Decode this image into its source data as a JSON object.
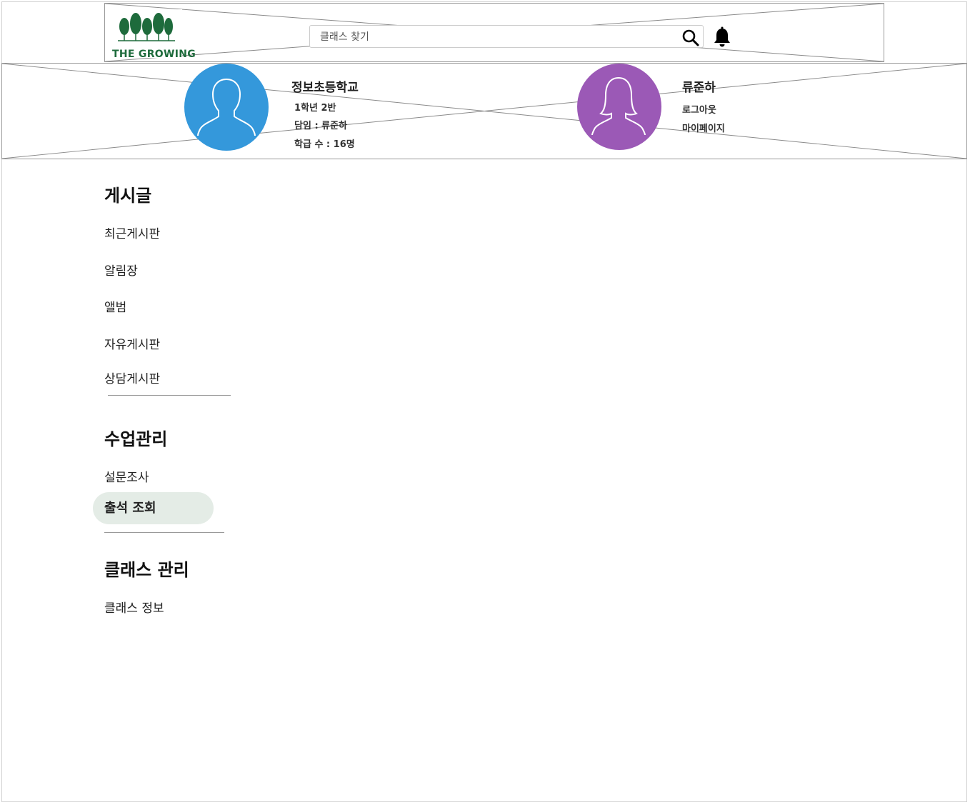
{
  "header": {
    "logo_text": "THE GROWING",
    "search": {
      "placeholder": "클래스 찾기",
      "value": ""
    },
    "icons": [
      "search-icon",
      "bell-icon"
    ]
  },
  "class_info": {
    "school": "정보초등학교",
    "grade_class": "1학년 2반",
    "teacher": "담임 : 류준하",
    "students": "학급 수 : 16명",
    "avatar_color": "#3498db"
  },
  "user": {
    "name": "류준하",
    "logout": "로그아웃",
    "mypage": "마이페이지",
    "avatar_color": "#9b59b6"
  },
  "sidebar": {
    "posts": {
      "title": "게시글",
      "items": [
        "최근게시판",
        "알림장",
        "앨범",
        "자유게시판",
        "상담게시판"
      ]
    },
    "lesson": {
      "title": "수업관리",
      "items": [
        "설문조사",
        "출석 조회"
      ],
      "active": "출석 조회"
    },
    "class_mgmt": {
      "title": "클래스 관리",
      "items": [
        "클래스 정보"
      ]
    }
  },
  "colors": {
    "brand_green": "#1e6b3c",
    "active_bg": "#e4ece6"
  }
}
